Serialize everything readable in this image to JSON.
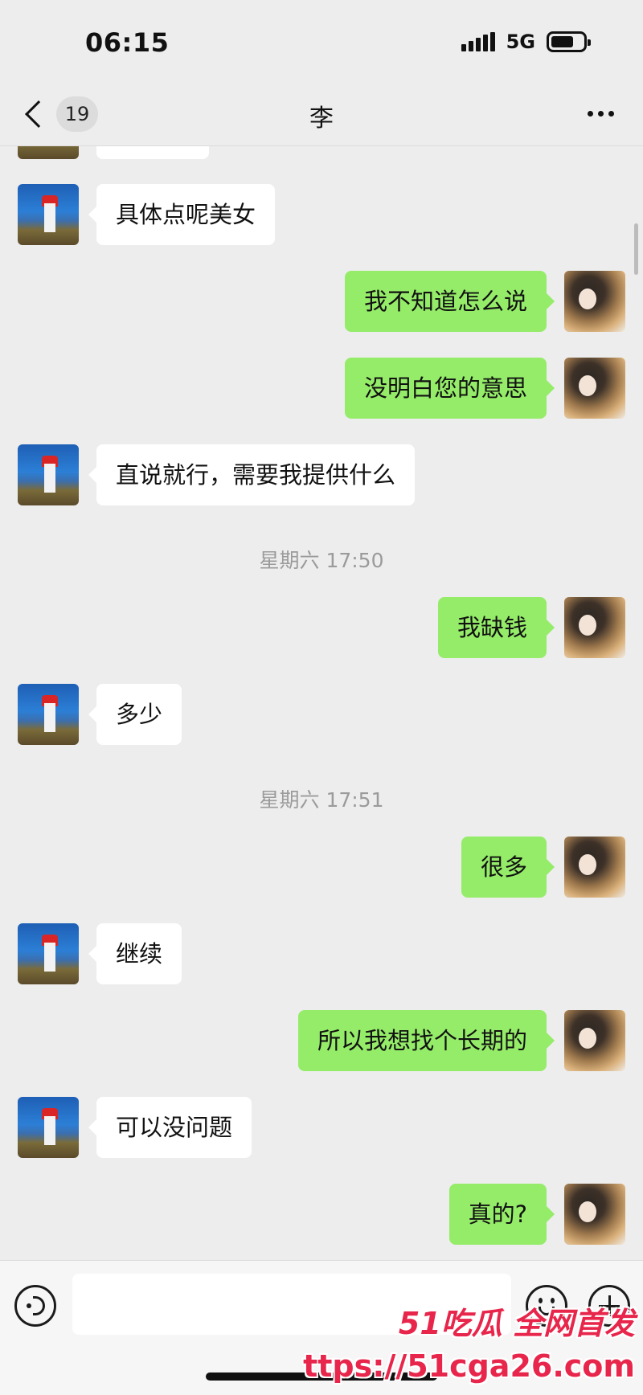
{
  "status_bar": {
    "time": "06:15",
    "network": "5G"
  },
  "header": {
    "unread_count": "19",
    "title": "李"
  },
  "messages": [
    {
      "side": "in",
      "text": "具体点呢美女"
    },
    {
      "side": "out",
      "text": "我不知道怎么说"
    },
    {
      "side": "out",
      "text": "没明白您的意思"
    },
    {
      "side": "in",
      "text": "直说就行，需要我提供什么"
    },
    {
      "side": "time",
      "text": "星期六 17:50"
    },
    {
      "side": "out",
      "text": "我缺钱"
    },
    {
      "side": "in",
      "text": "多少"
    },
    {
      "side": "time",
      "text": "星期六 17:51"
    },
    {
      "side": "out",
      "text": "很多"
    },
    {
      "side": "in",
      "text": "继续"
    },
    {
      "side": "out",
      "text": "所以我想找个长期的"
    },
    {
      "side": "in",
      "text": "可以没问题"
    },
    {
      "side": "out",
      "text": "真的?"
    }
  ],
  "input": {
    "value": ""
  },
  "watermark": {
    "line1": "51吃瓜 全网首发",
    "line2": "ttps://51cga26.com"
  },
  "colors": {
    "background": "#ededed",
    "outgoing_bubble": "#95ec69",
    "incoming_bubble": "#ffffff",
    "watermark": "#e8254b"
  }
}
